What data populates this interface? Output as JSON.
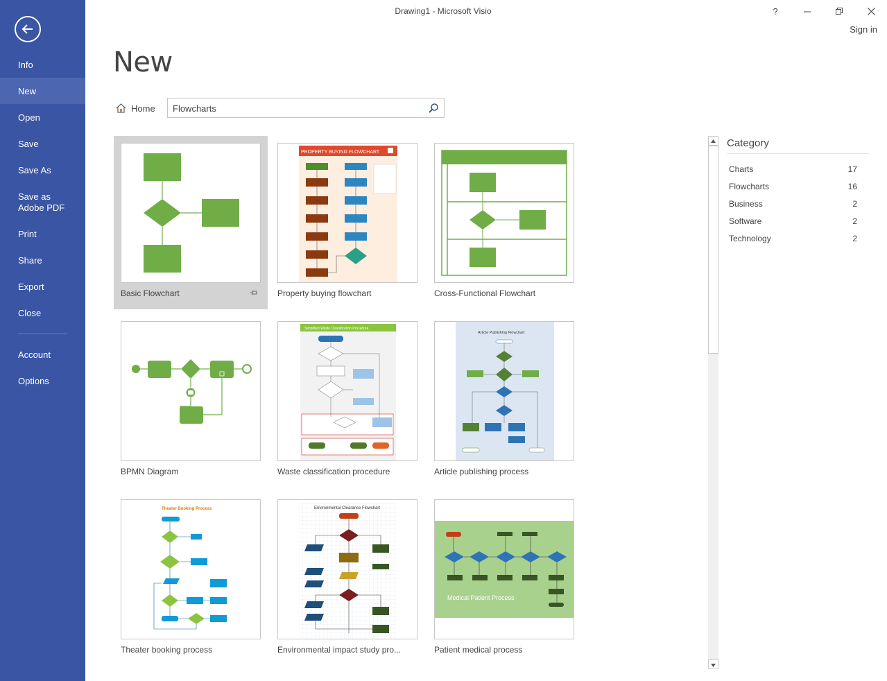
{
  "window": {
    "title": "Drawing1 - Microsoft Visio",
    "sign_in": "Sign in"
  },
  "nav": {
    "items": [
      {
        "label": "Info"
      },
      {
        "label": "New",
        "active": true
      },
      {
        "label": "Open"
      },
      {
        "label": "Save"
      },
      {
        "label": "Save As"
      },
      {
        "label": "Save as Adobe PDF"
      },
      {
        "label": "Print"
      },
      {
        "label": "Share"
      },
      {
        "label": "Export"
      },
      {
        "label": "Close"
      },
      {
        "label": "Account"
      },
      {
        "label": "Options"
      }
    ]
  },
  "page": {
    "title": "New",
    "home_label": "Home"
  },
  "search": {
    "value": "Flowcharts"
  },
  "templates": [
    {
      "label": "Basic Flowchart",
      "selected": true
    },
    {
      "label": "Property buying flowchart"
    },
    {
      "label": "Cross-Functional Flowchart"
    },
    {
      "label": "BPMN Diagram"
    },
    {
      "label": "Waste classification procedure"
    },
    {
      "label": "Article publishing process"
    },
    {
      "label": "Theater booking process"
    },
    {
      "label": "Environmental impact study pro..."
    },
    {
      "label": "Patient medical process"
    }
  ],
  "thumbs": {
    "property_title": "PROPERTY BUYING FLOWCHART",
    "waste_title": "Simplified Waste Classification Procedure",
    "article_title": "Article Publishing Flowchart",
    "theater_title": "Theater Booking Process",
    "env_title": "Environmental Clearance Flowchart",
    "patient_title": "Medical Patient Process"
  },
  "category": {
    "title": "Category",
    "items": [
      {
        "name": "Charts",
        "count": "17"
      },
      {
        "name": "Flowcharts",
        "count": "16"
      },
      {
        "name": "Business",
        "count": "2"
      },
      {
        "name": "Software",
        "count": "2"
      },
      {
        "name": "Technology",
        "count": "2"
      }
    ]
  },
  "colors": {
    "sidebar": "#3955a3",
    "sidebar_active": "#4c67b0",
    "shape_green": "#70ad47",
    "selected_tile": "#d3d3d3"
  }
}
